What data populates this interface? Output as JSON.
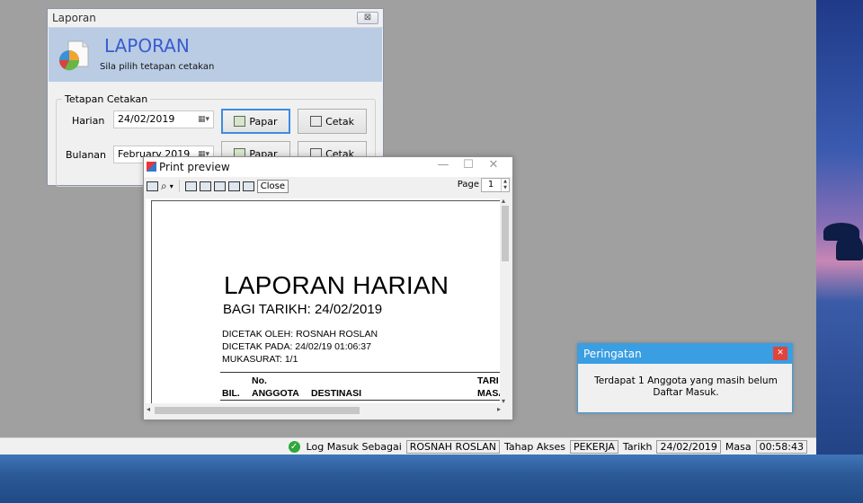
{
  "laporan_window": {
    "title": "Laporan",
    "close_glyph": "⊠",
    "banner_title": "LAPORAN",
    "banner_subtitle": "Sila pilih tetapan cetakan",
    "group_title": "Tetapan Cetakan",
    "harian_label": "Harian",
    "harian_value": "24/02/2019",
    "bulanan_label": "Bulanan",
    "bulanan_value": "February 2019",
    "papar_label": "Papar",
    "cetak_label": "Cetak",
    "icon": "pie-chart-report-icon"
  },
  "print_preview": {
    "title": "Print preview",
    "close_label": "Close",
    "page_label": "Page",
    "page_value": "1",
    "icons": [
      "print-icon",
      "zoom-icon",
      "one-page-icon",
      "two-pages-icon",
      "three-pages-icon",
      "four-pages-icon",
      "six-pages-icon"
    ],
    "report": {
      "title": "LAPORAN HARIAN",
      "subtitle": "BAGI TARIKH: 24/02/2019",
      "printed_by": "DICETAK OLEH: ROSNAH ROSLAN",
      "printed_at": "DICETAK PADA: 24/02/19 01:06:37",
      "page_info": "MUKASURAT: 1/1",
      "col_bil": "BIL.",
      "col_no": "No.",
      "col_anggota": "ANGGOTA",
      "col_destinasi": "DESTINASI",
      "col_tarikh_partial": "TARI",
      "col_masa_partial": "MASA"
    }
  },
  "warning": {
    "title": "Peringatan",
    "close_glyph": "✕",
    "message_line1": "Terdapat 1 Anggota yang masih belum",
    "message_line2": "Daftar Masuk."
  },
  "statusbar": {
    "login_label": "Log Masuk Sebagai",
    "user_name": "ROSNAH ROSLAN",
    "access_label": "Tahap Akses",
    "access_value": "PEKERJA",
    "date_label": "Tarikh",
    "date_value": "24/02/2019",
    "time_label": "Masa",
    "time_value": "00:58:43"
  },
  "colors": {
    "banner": "#b9cce4",
    "banner_title": "#3a5bd0",
    "warning_titlebar": "#3a9ee2",
    "warning_close": "#e0453b"
  }
}
